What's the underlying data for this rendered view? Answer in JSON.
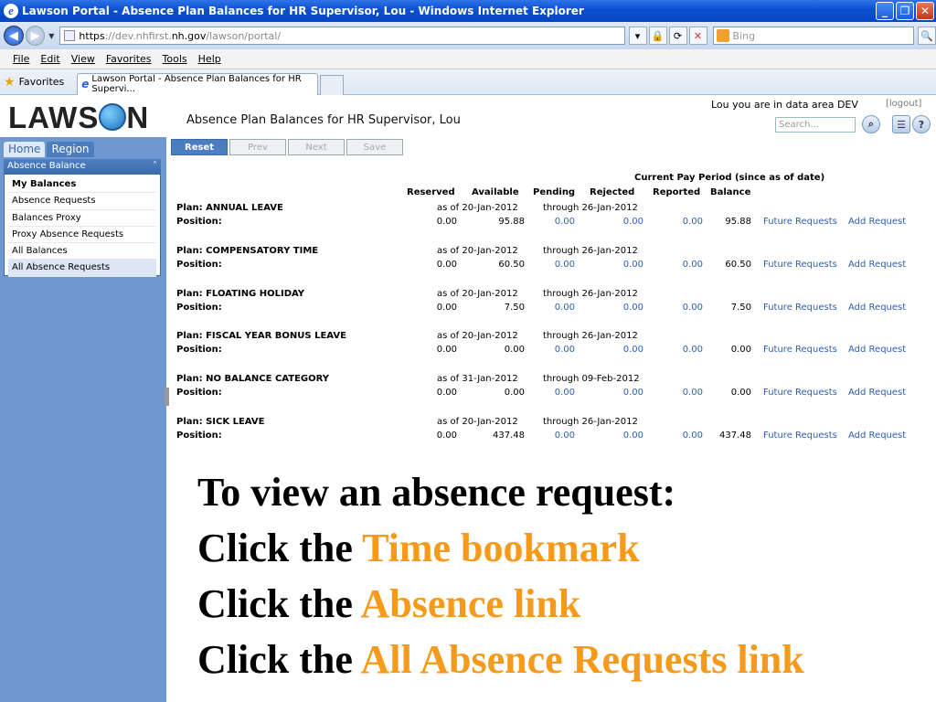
{
  "window": {
    "title": "Lawson Portal - Absence Plan Balances for HR Supervisor, Lou - Windows Internet Explorer",
    "min": "_",
    "max": "❐",
    "close": "✕"
  },
  "address": {
    "url_prefix": "https",
    "url_mid": "://dev.nhfirst.",
    "url_host": "nh.gov",
    "url_path": "/lawson/portal/",
    "search_placeholder": "Bing"
  },
  "menu": [
    "File",
    "Edit",
    "View",
    "Favorites",
    "Tools",
    "Help"
  ],
  "favorites": {
    "label": "Favorites",
    "tab_title": "Lawson Portal - Absence Plan Balances for HR Supervi..."
  },
  "header": {
    "logo": "LAWSON",
    "page_title": "Absence Plan Balances for HR Supervisor, Lou",
    "user_line": "Lou you are in data area DEV",
    "logout": "[logout]",
    "search_placeholder": "Search..."
  },
  "sidebar": {
    "tabs": [
      "Home",
      "Region"
    ],
    "panel_title": "Absence Balance",
    "items": [
      {
        "label": "My Balances"
      },
      {
        "label": "Absence Requests"
      },
      {
        "label": "Balances Proxy"
      },
      {
        "label": "Proxy Absence Requests"
      },
      {
        "label": "All Balances"
      },
      {
        "label": "All Absence Requests"
      }
    ]
  },
  "toolbar": [
    "Reset",
    "Prev",
    "Next",
    "Save"
  ],
  "table": {
    "period_header": "Current Pay Period (since as of date)",
    "columns": [
      "Reserved",
      "Available",
      "Pending",
      "Rejected",
      "Reported",
      "Balance"
    ],
    "position_label": "Position:",
    "future_label": "Future Requests",
    "add_label": "Add Request",
    "plans": [
      {
        "name": "Plan: ANNUAL LEAVE",
        "as_of": "as of 20-Jan-2012",
        "through": "through 26-Jan-2012",
        "reserved": "0.00",
        "available": "95.88",
        "pending": "0.00",
        "rejected": "0.00",
        "reported": "0.00",
        "balance": "95.88"
      },
      {
        "name": "Plan: COMPENSATORY TIME",
        "as_of": "as of 20-Jan-2012",
        "through": "through 26-Jan-2012",
        "reserved": "0.00",
        "available": "60.50",
        "pending": "0.00",
        "rejected": "0.00",
        "reported": "0.00",
        "balance": "60.50"
      },
      {
        "name": "Plan: FLOATING HOLIDAY",
        "as_of": "as of 20-Jan-2012",
        "through": "through 26-Jan-2012",
        "reserved": "0.00",
        "available": "7.50",
        "pending": "0.00",
        "rejected": "0.00",
        "reported": "0.00",
        "balance": "7.50"
      },
      {
        "name": "Plan: FISCAL YEAR BONUS LEAVE",
        "as_of": "as of 20-Jan-2012",
        "through": "through 26-Jan-2012",
        "reserved": "0.00",
        "available": "0.00",
        "pending": "0.00",
        "rejected": "0.00",
        "reported": "0.00",
        "balance": "0.00"
      },
      {
        "name": "Plan: NO BALANCE CATEGORY",
        "as_of": "as of 31-Jan-2012",
        "through": "through 09-Feb-2012",
        "reserved": "0.00",
        "available": "0.00",
        "pending": "0.00",
        "rejected": "0.00",
        "reported": "0.00",
        "balance": "0.00"
      },
      {
        "name": "Plan: SICK LEAVE",
        "as_of": "as of 20-Jan-2012",
        "through": "through 26-Jan-2012",
        "reserved": "0.00",
        "available": "437.48",
        "pending": "0.00",
        "rejected": "0.00",
        "reported": "0.00",
        "balance": "437.48"
      }
    ]
  },
  "instructions": {
    "heading": "To view an absence request:",
    "click_prefix": "Click the ",
    "steps": [
      "Time bookmark",
      "Absence link",
      "All Absence Requests link"
    ]
  },
  "colors": {
    "highlight": "#f59a1b",
    "link": "#2e5fae",
    "sidebar": "#6e98cf"
  }
}
